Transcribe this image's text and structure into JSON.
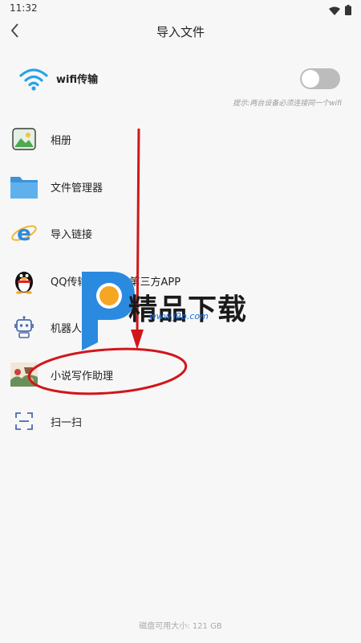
{
  "status_bar": {
    "time": "11:32",
    "icons": [
      "wifi-icon",
      "battery-icon"
    ]
  },
  "header": {
    "title": "导入文件",
    "back_icon": "chevron-left-icon"
  },
  "wifi_transfer": {
    "label": "wifi传输",
    "enabled": false,
    "hint": "提示:两台设备必须连接同一个wifi"
  },
  "items": [
    {
      "label": "相册",
      "icon": "photo-album-icon"
    },
    {
      "label": "文件管理器",
      "icon": "folder-icon"
    },
    {
      "label": "导入链接",
      "icon": "browser-link-icon"
    },
    {
      "label": "QQ传输或者其它第三方APP",
      "icon": "qq-penguin-icon"
    },
    {
      "label": "机器人",
      "icon": "robot-icon"
    },
    {
      "label": "小说写作助理",
      "icon": "novel-assistant-icon"
    },
    {
      "label": "扫一扫",
      "icon": "scan-icon"
    }
  ],
  "footer": {
    "storage": "磁盘可用大小: 121 GB"
  },
  "watermark": {
    "brand": "精品下载",
    "url": "www.j9p.com"
  },
  "colors": {
    "annotation_red": "#d1161b",
    "toggle_off": "#bcbcbc",
    "folder_blue": "#4aa3e8",
    "ie_blue": "#2a8ae0"
  }
}
